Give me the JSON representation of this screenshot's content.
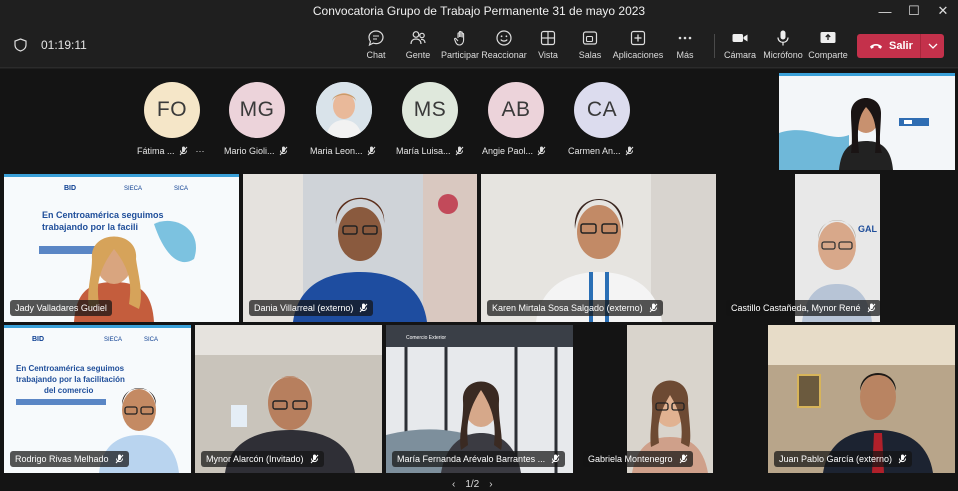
{
  "window": {
    "title": "Convocatoria Grupo de Trabajo Permanente 31 de mayo 2023",
    "controls": [
      "—",
      "☐",
      "✕"
    ]
  },
  "toolbar": {
    "timer": "01:19:11",
    "buttons": [
      {
        "label": "Chat",
        "icon": "chat-icon"
      },
      {
        "label": "Gente",
        "icon": "people-icon"
      },
      {
        "label": "Participar",
        "icon": "raise-hand-icon"
      },
      {
        "label": "Reaccionar",
        "icon": "emoji-icon"
      },
      {
        "label": "Vista",
        "icon": "grid-view-icon"
      },
      {
        "label": "Salas",
        "icon": "breakout-rooms-icon"
      },
      {
        "label": "Aplicaciones",
        "icon": "apps-icon"
      },
      {
        "label": "Más",
        "icon": "more-icon"
      },
      {
        "label": "Cámara",
        "icon": "camera-icon"
      },
      {
        "label": "Micrófono",
        "icon": "microphone-icon"
      },
      {
        "label": "Comparte",
        "icon": "share-icon"
      }
    ],
    "leave_label": "Salir",
    "leave_color": "#c4314b"
  },
  "avatars": [
    {
      "initials": "FO",
      "name": "Fátima ...",
      "color": "#f5e6c8"
    },
    {
      "initials": "MG",
      "name": "Mario Gioli...",
      "color": "#ecd3da"
    },
    {
      "initials": "",
      "name": "Maria Leon...",
      "color": "#c9d7e0"
    },
    {
      "initials": "MS",
      "name": "María Luisa...",
      "color": "#dfe8dc"
    },
    {
      "initials": "AB",
      "name": "Angie Paol...",
      "color": "#ecd3da"
    },
    {
      "initials": "CA",
      "name": "Carmen An...",
      "color": "#dcdcee"
    }
  ],
  "slide": {
    "logos": [
      "BID",
      "SIECA",
      "SICA"
    ],
    "text": "En Centroamérica seguimos trabajando por la facilitación del comercio"
  },
  "participants": [
    {
      "name": "Jady Valladares Gudiel"
    },
    {
      "name": "Dania Villarreal (externo)"
    },
    {
      "name": "Karen Mirtala Sosa Salgado (externo)"
    },
    {
      "name": "Castillo Castañeda, Mynor René"
    },
    {
      "name": "Rodrigo Rivas Melhado"
    },
    {
      "name": "Mynor Alarcón (Invitado)"
    },
    {
      "name": "María Fernanda Arévalo Barrantes ..."
    },
    {
      "name": "Gabriela Montenegro"
    },
    {
      "name": "Juan Pablo García (externo)"
    }
  ],
  "pager": {
    "text": "1/2",
    "prev": "‹",
    "next": "›"
  }
}
